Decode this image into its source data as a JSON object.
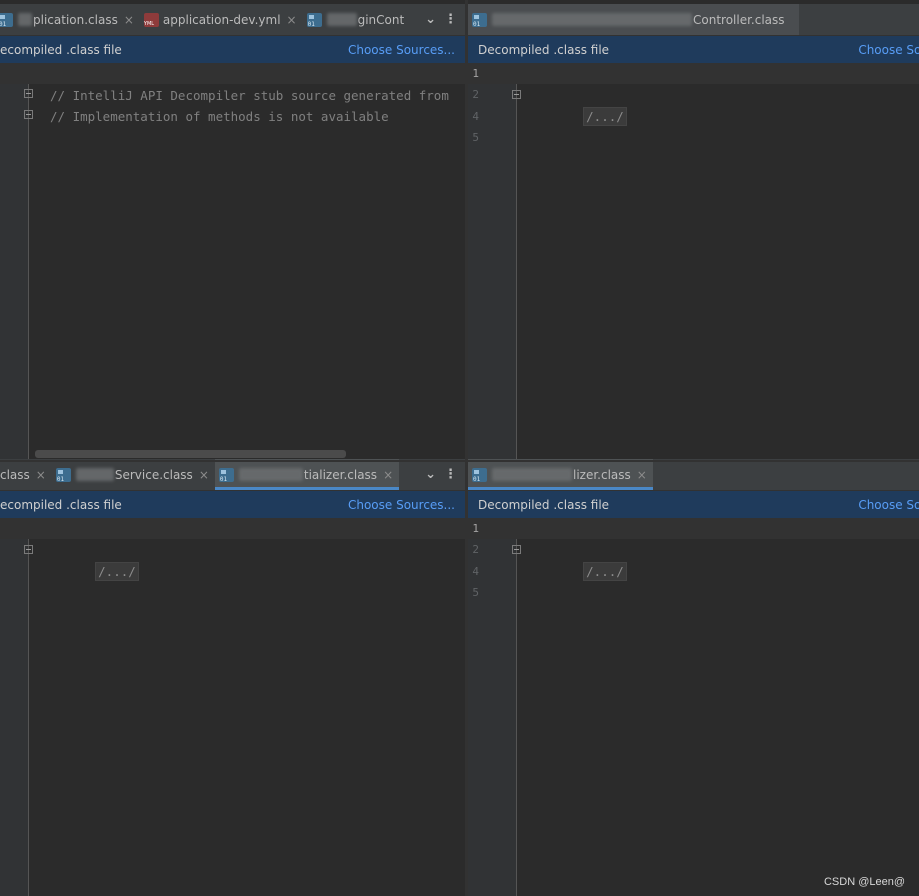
{
  "panes": {
    "top_left": {
      "tabs": [
        {
          "label": "plication.class",
          "icon": "class-file-icon",
          "active": false
        },
        {
          "label": "application-dev.yml",
          "icon": "yml-file-icon",
          "active": false
        },
        {
          "label": "ginCont",
          "icon": "class-file-icon",
          "active": false
        }
      ],
      "banner_text": "ecompiled .class file",
      "banner_link": "Choose Sources...",
      "lines": [
        "// IntelliJ API Decompiler stub source generated from",
        "// Implementation of methods is not available"
      ]
    },
    "top_right": {
      "tabs": [
        {
          "label": "Controller.class",
          "icon": "class-file-icon",
          "active": false
        }
      ],
      "banner_text": "Decompiled .class file",
      "banner_link": "Choose Sou",
      "line_numbers": [
        "1",
        "2",
        "4",
        "5"
      ],
      "folded": "/.../"
    },
    "bottom_left": {
      "tabs": [
        {
          "label": "class",
          "icon": "",
          "active": false
        },
        {
          "label": "Service.class",
          "icon": "class-file-icon",
          "active": false
        },
        {
          "label": "tializer.class",
          "icon": "class-file-icon",
          "active": true
        }
      ],
      "banner_text": "ecompiled .class file",
      "banner_link": "Choose Sources...",
      "folded": "/.../"
    },
    "bottom_right": {
      "tabs": [
        {
          "label": "lizer.class",
          "icon": "class-file-icon",
          "active": true
        }
      ],
      "banner_text": "Decompiled .class file",
      "banner_link": "Choose Sou",
      "line_numbers": [
        "1",
        "2",
        "4",
        "5"
      ],
      "folded": "/.../"
    }
  },
  "tab_tools": {
    "dropdown": "⌄",
    "more": "⋮"
  },
  "watermark": "CSDN @Leen@",
  "colors": {
    "banner_bg": "#1f3b5c",
    "link": "#589df6",
    "editor_bg": "#2b2b2b",
    "tab_accent": "#4a88c7"
  }
}
